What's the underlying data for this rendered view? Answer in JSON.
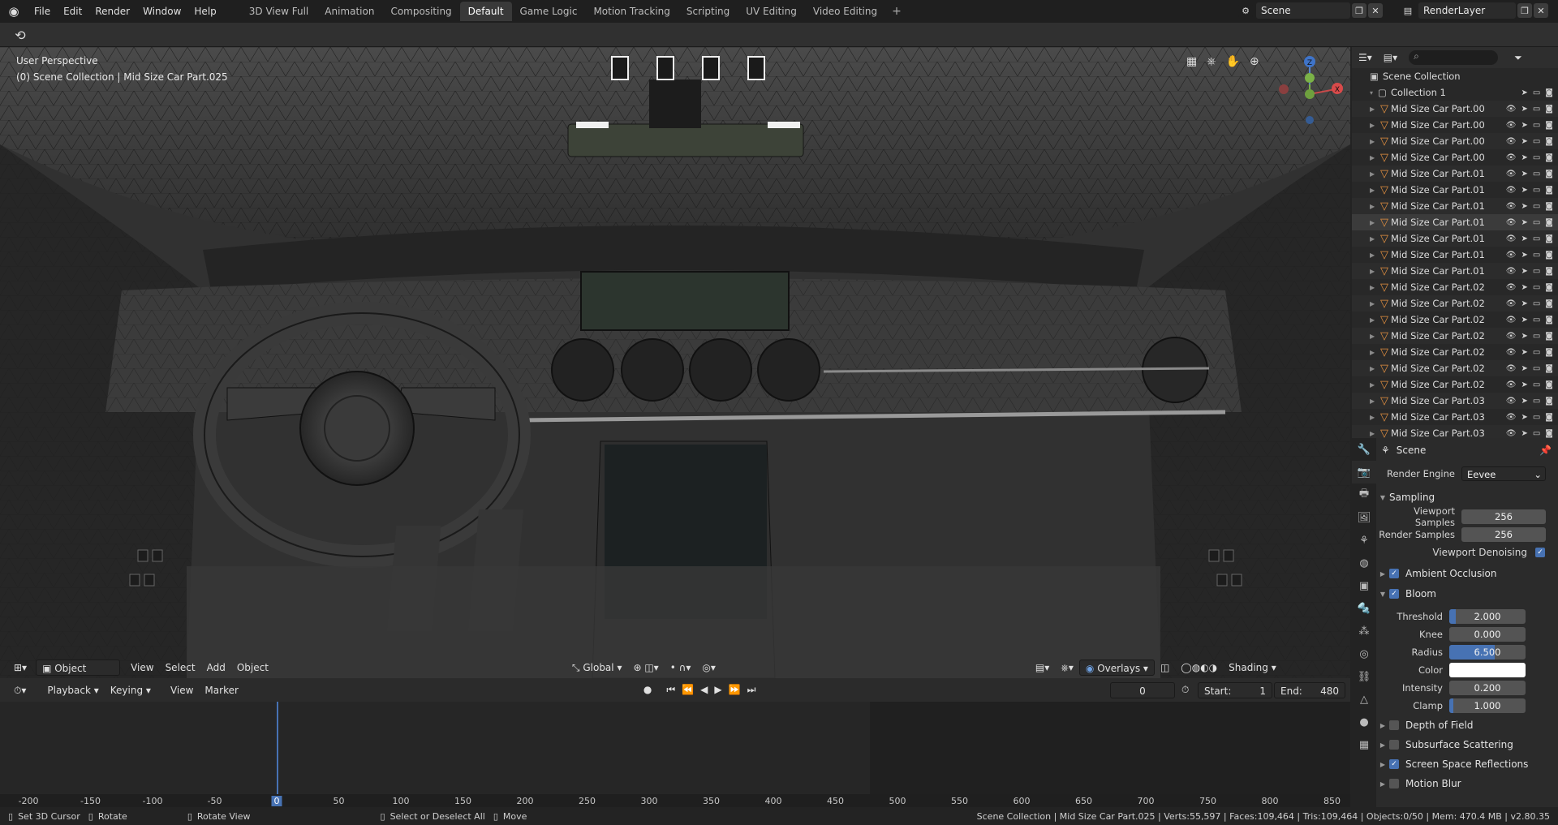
{
  "menu": {
    "file": "File",
    "edit": "Edit",
    "render": "Render",
    "window": "Window",
    "help": "Help"
  },
  "workspaces": [
    "3D View Full",
    "Animation",
    "Compositing",
    "Default",
    "Game Logic",
    "Motion Tracking",
    "Scripting",
    "UV Editing",
    "Video Editing"
  ],
  "active_workspace": "Default",
  "scene": {
    "name": "Scene",
    "render_layer": "RenderLayer"
  },
  "viewport": {
    "perspective_label": "User Perspective",
    "collection_label": "(0) Scene Collection | Mid Size Car Part.025",
    "mode": "Object Mode",
    "menus": [
      "View",
      "Select",
      "Add",
      "Object"
    ],
    "orientation": "Global",
    "overlays_label": "Overlays",
    "shading_label": "Shading",
    "gizmo": {
      "z": "Z",
      "x": "X"
    }
  },
  "timeline": {
    "menus": [
      "Playback",
      "Keying",
      "View",
      "Marker"
    ],
    "current_frame": "0",
    "start_label": "Start:",
    "start": "1",
    "end_label": "End:",
    "end": "480",
    "ticks": [
      "-200",
      "-150",
      "-100",
      "-50",
      "0",
      "50",
      "100",
      "150",
      "200",
      "250",
      "300",
      "350",
      "400",
      "450",
      "500",
      "550",
      "600",
      "650",
      "700",
      "750",
      "800",
      "850"
    ]
  },
  "outliner": {
    "root": "Scene Collection",
    "collection": "Collection 1",
    "items": [
      "Mid Size Car Part.00",
      "Mid Size Car Part.00",
      "Mid Size Car Part.00",
      "Mid Size Car Part.00",
      "Mid Size Car Part.01",
      "Mid Size Car Part.01",
      "Mid Size Car Part.01",
      "Mid Size Car Part.01",
      "Mid Size Car Part.01",
      "Mid Size Car Part.01",
      "Mid Size Car Part.01",
      "Mid Size Car Part.02",
      "Mid Size Car Part.02",
      "Mid Size Car Part.02",
      "Mid Size Car Part.02",
      "Mid Size Car Part.02",
      "Mid Size Car Part.02",
      "Mid Size Car Part.02",
      "Mid Size Car Part.03",
      "Mid Size Car Part.03",
      "Mid Size Car Part.03"
    ]
  },
  "properties": {
    "context": "Scene",
    "render_engine_label": "Render Engine",
    "render_engine": "Eevee",
    "sampling_label": "Sampling",
    "viewport_samples_label": "Viewport Samples",
    "viewport_samples": "256",
    "render_samples_label": "Render Samples",
    "render_samples": "256",
    "viewport_denoising_label": "Viewport Denoising",
    "ambient_occlusion": "Ambient Occlusion",
    "bloom": "Bloom",
    "threshold_label": "Threshold",
    "threshold": "2.000",
    "threshold_fill": 0.08,
    "knee_label": "Knee",
    "knee": "0.000",
    "radius_label": "Radius",
    "radius": "6.500",
    "radius_fill": 0.6,
    "color_label": "Color",
    "intensity_label": "Intensity",
    "intensity": "0.200",
    "clamp_label": "Clamp",
    "clamp": "1.000",
    "clamp_fill": 0.05,
    "depth_of_field": "Depth of Field",
    "subsurface": "Subsurface Scattering",
    "ssr": "Screen Space Reflections",
    "motion_blur": "Motion Blur"
  },
  "status": {
    "set_cursor": "Set 3D Cursor",
    "rotate": "Rotate",
    "rotate_view": "Rotate View",
    "select": "Select or Deselect All",
    "move": "Move",
    "stats": "Scene Collection | Mid Size Car Part.025 | Verts:55,597 | Faces:109,464 | Tris:109,464 | Objects:0/50 | Mem: 470.4 MB | v2.80.35"
  }
}
